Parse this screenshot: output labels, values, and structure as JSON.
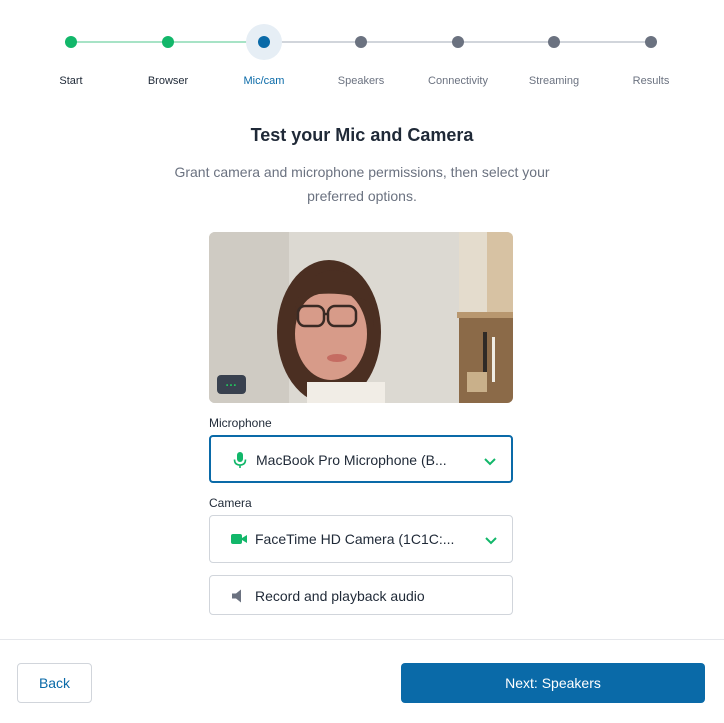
{
  "stepper": {
    "steps": [
      {
        "label": "Start",
        "state": "done"
      },
      {
        "label": "Browser",
        "state": "done"
      },
      {
        "label": "Mic/cam",
        "state": "active"
      },
      {
        "label": "Speakers",
        "state": "pending"
      },
      {
        "label": "Connectivity",
        "state": "pending"
      },
      {
        "label": "Streaming",
        "state": "pending"
      },
      {
        "label": "Results",
        "state": "pending"
      }
    ]
  },
  "main": {
    "title": "Test your Mic and Camera",
    "subtitle": "Grant camera and microphone permissions, then select your preferred options."
  },
  "video": {
    "menu_glyph": "…"
  },
  "microphone": {
    "label": "Microphone",
    "value": "MacBook Pro Microphone (B...",
    "icon": "microphone-icon"
  },
  "camera": {
    "label": "Camera",
    "value": "FaceTime HD Camera (1C1C:...",
    "icon": "video-camera-icon"
  },
  "record": {
    "label": "Record and playback audio",
    "icon": "speaker-icon"
  },
  "footer": {
    "back_label": "Back",
    "next_label": "Next: Speakers"
  },
  "colors": {
    "accent": "#0a6aa8",
    "success": "#12b76a",
    "pending": "#6b7280"
  }
}
